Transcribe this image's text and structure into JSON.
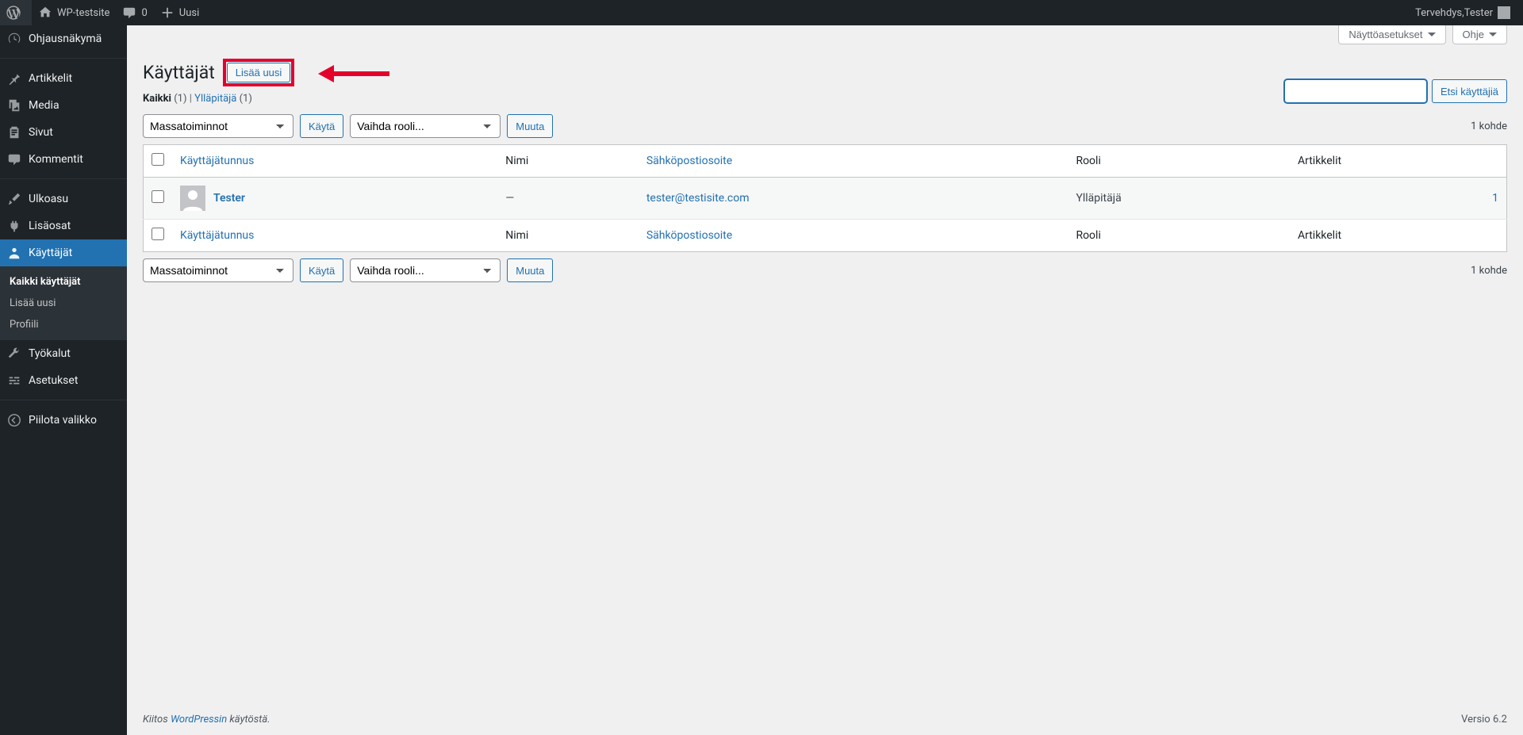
{
  "adminbar": {
    "site_name": "WP-testsite",
    "comments_count": "0",
    "new_label": "Uusi",
    "howdy_prefix": "Tervehdys, ",
    "user_display": "Tester"
  },
  "sidemenu": {
    "dashboard": "Ohjausnäkymä",
    "posts": "Artikkelit",
    "media": "Media",
    "pages": "Sivut",
    "comments": "Kommentit",
    "appearance": "Ulkoasu",
    "plugins": "Lisäosat",
    "users": "Käyttäjät",
    "tools": "Työkalut",
    "settings": "Asetukset",
    "collapse": "Piilota valikko",
    "submenu": {
      "all_users": "Kaikki käyttäjät",
      "add_new": "Lisää uusi",
      "profile": "Profiili"
    }
  },
  "screen_meta": {
    "screen_options": "Näyttöasetukset",
    "help": "Ohje"
  },
  "heading": "Käyttäjät",
  "add_new_button": "Lisää uusi",
  "subsubsub": {
    "all_label": "Kaikki",
    "all_count": "(1)",
    "sep": "  |  ",
    "admin_label": "Ylläpitäjä",
    "admin_count": "(1)"
  },
  "search": {
    "placeholder": "",
    "button": "Etsi käyttäjiä"
  },
  "bulk": {
    "action_placeholder": "Massatoiminnot",
    "apply": "Käytä",
    "role_placeholder": "Vaihda rooli...",
    "change": "Muuta"
  },
  "pagination": {
    "items_text": "1 kohde"
  },
  "columns": {
    "username": "Käyttäjätunnus",
    "name": "Nimi",
    "email": "Sähköpostiosoite",
    "role": "Rooli",
    "posts": "Artikkelit"
  },
  "rows": [
    {
      "username": "Tester",
      "name": "—",
      "email": "tester@testisite.com",
      "role": "Ylläpitäjä",
      "posts": "1"
    }
  ],
  "footer": {
    "thanks_pre": "Kiitos ",
    "wp_link": "WordPressin",
    "thanks_post": " käytöstä.",
    "version": "Versio 6.2"
  }
}
